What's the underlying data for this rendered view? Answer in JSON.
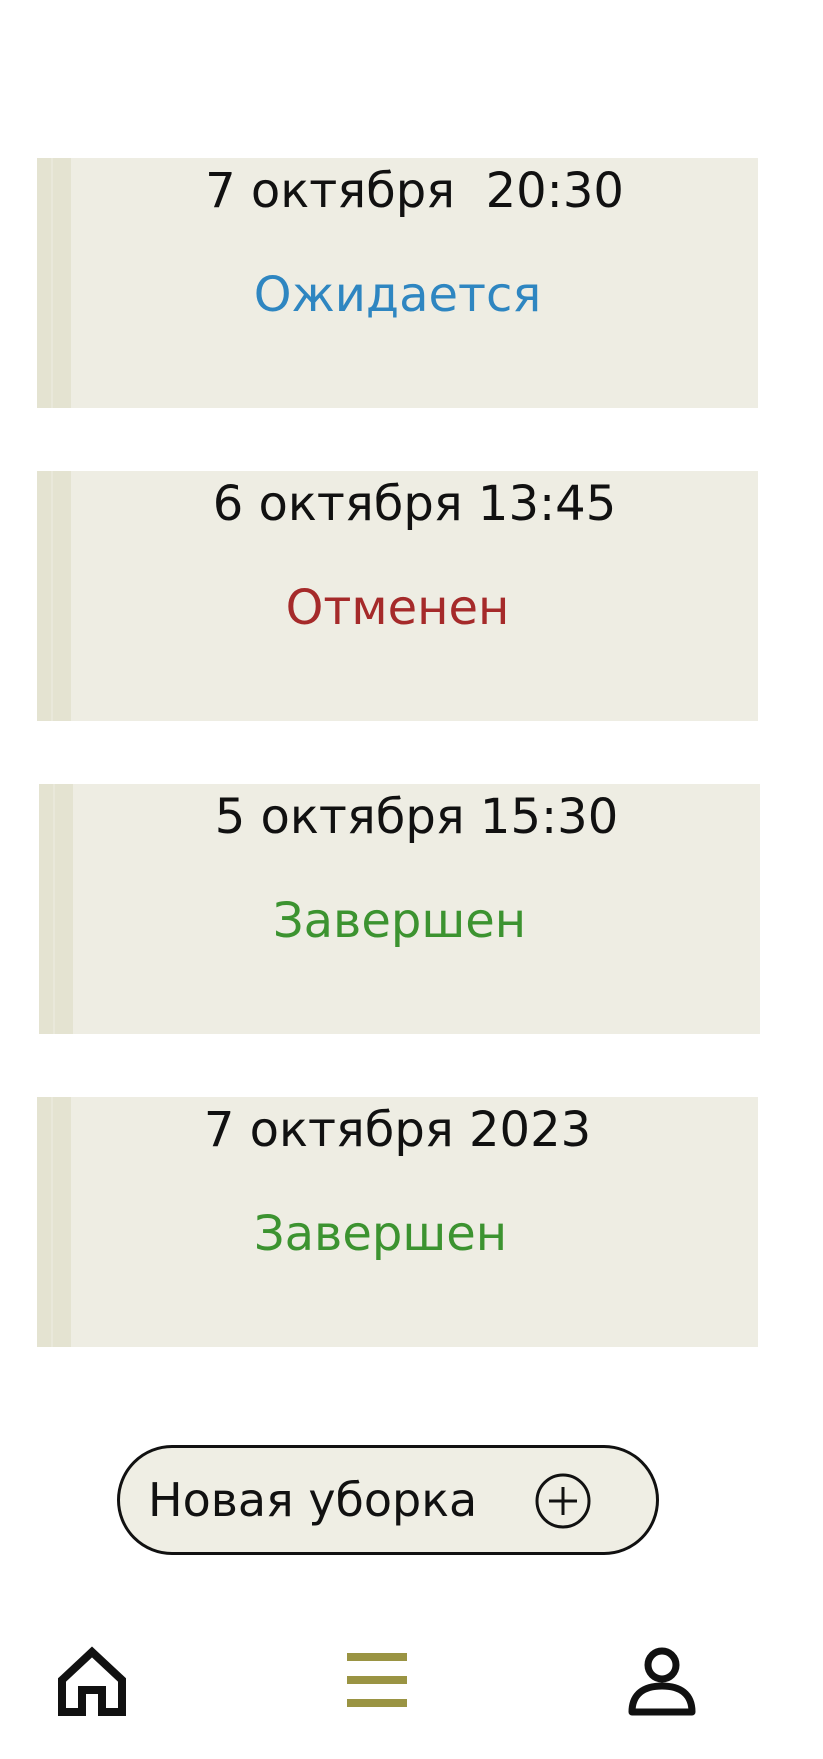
{
  "orders": [
    {
      "date": "7 октября  20:30",
      "status": "Ожидается",
      "status_type": "pending",
      "status_color": "#2e86c1"
    },
    {
      "date": "6 октября 13:45",
      "status": "Отменен",
      "status_type": "cancelled",
      "status_color": "#a52a2a"
    },
    {
      "date": "5 октября 15:30",
      "status": "Завершен",
      "status_type": "done",
      "status_color": "#3c9330"
    },
    {
      "date": "7 октября 2023",
      "status": "Завершен",
      "status_type": "done",
      "status_color": "#3c9330"
    }
  ],
  "new_cleaning_button": {
    "label": "Новая уборка",
    "icon": "plus-circle-icon"
  },
  "bottom_nav": {
    "items": [
      {
        "icon": "home-icon",
        "active": false
      },
      {
        "icon": "menu-icon",
        "active": true
      },
      {
        "icon": "profile-icon",
        "active": false
      }
    ],
    "active_color": "#9a9443",
    "inactive_color": "#111111"
  },
  "colors": {
    "card_background": "#eeede3",
    "card_strip": "#e4e3d1"
  }
}
